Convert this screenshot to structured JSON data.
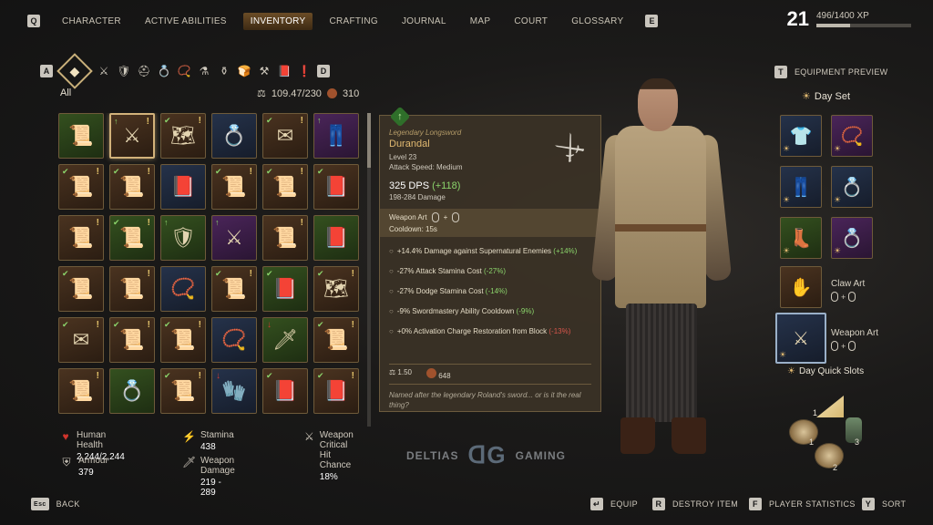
{
  "topnav": {
    "key_left": "Q",
    "key_right": "E",
    "tabs": [
      {
        "label": "CHARACTER",
        "active": false
      },
      {
        "label": "ACTIVE ABILITIES",
        "active": false
      },
      {
        "label": "INVENTORY",
        "active": true
      },
      {
        "label": "CRAFTING",
        "active": false
      },
      {
        "label": "JOURNAL",
        "active": false
      },
      {
        "label": "MAP",
        "active": false
      },
      {
        "label": "COURT",
        "active": false
      },
      {
        "label": "GLOSSARY",
        "active": false
      }
    ]
  },
  "player": {
    "level": "21",
    "xp_text": "496/1400 XP",
    "xp_progress": 0.354
  },
  "categories": {
    "key_left": "A",
    "key_right": "D",
    "filter_label": "All",
    "icons": [
      "all-icon",
      "sword-icon",
      "armor-icon",
      "helmet-icon",
      "ring-icon",
      "amulet-icon",
      "potion-icon",
      "mortar-icon",
      "food-icon",
      "crafting-icon",
      "book-icon",
      "quest-icon"
    ]
  },
  "inventory": {
    "weight": "109.47/230",
    "money": "310",
    "items": [
      {
        "bg": "green",
        "icon": "scroll-icon",
        "ribbon": false,
        "mark": false,
        "up": false,
        "down": false
      },
      {
        "bg": "brown",
        "icon": "sword-icon",
        "ribbon": false,
        "mark": true,
        "up": true,
        "down": false,
        "selected": true
      },
      {
        "bg": "brown",
        "icon": "map-icon",
        "ribbon": true,
        "mark": true,
        "up": false,
        "down": false
      },
      {
        "bg": "blue",
        "icon": "ring-icon",
        "ribbon": false,
        "mark": false,
        "up": false,
        "down": false
      },
      {
        "bg": "brown",
        "icon": "letter-icon",
        "ribbon": true,
        "mark": true,
        "up": false,
        "down": false
      },
      {
        "bg": "purple",
        "icon": "leggings-icon",
        "ribbon": false,
        "mark": false,
        "up": true,
        "down": false
      },
      {
        "bg": "brown",
        "icon": "scroll-icon",
        "ribbon": true,
        "mark": true,
        "up": false,
        "down": false
      },
      {
        "bg": "brown",
        "icon": "scroll-icon",
        "ribbon": true,
        "mark": true,
        "up": false,
        "down": false
      },
      {
        "bg": "blue",
        "icon": "book-icon",
        "ribbon": false,
        "mark": false,
        "up": false,
        "down": false
      },
      {
        "bg": "brown",
        "icon": "scroll-icon",
        "ribbon": true,
        "mark": true,
        "up": false,
        "down": false
      },
      {
        "bg": "brown",
        "icon": "scroll-icon",
        "ribbon": true,
        "mark": true,
        "up": false,
        "down": false
      },
      {
        "bg": "brown",
        "icon": "book-icon",
        "ribbon": true,
        "mark": false,
        "up": false,
        "down": false
      },
      {
        "bg": "brown",
        "icon": "scroll-icon",
        "ribbon": false,
        "mark": true,
        "up": false,
        "down": false
      },
      {
        "bg": "green",
        "icon": "scroll-icon",
        "ribbon": true,
        "mark": true,
        "up": false,
        "down": false
      },
      {
        "bg": "green",
        "icon": "armor-icon",
        "ribbon": false,
        "mark": false,
        "up": true,
        "down": false
      },
      {
        "bg": "purple",
        "icon": "sword-icon",
        "ribbon": false,
        "mark": false,
        "up": true,
        "down": false
      },
      {
        "bg": "brown",
        "icon": "scroll-icon",
        "ribbon": false,
        "mark": true,
        "up": false,
        "down": false
      },
      {
        "bg": "green",
        "icon": "book-icon",
        "ribbon": false,
        "mark": false,
        "up": false,
        "down": false
      },
      {
        "bg": "brown",
        "icon": "scroll-icon",
        "ribbon": true,
        "mark": false,
        "up": false,
        "down": false
      },
      {
        "bg": "brown",
        "icon": "scroll-icon",
        "ribbon": false,
        "mark": true,
        "up": false,
        "down": false
      },
      {
        "bg": "blue",
        "icon": "amulet-icon",
        "ribbon": false,
        "mark": false,
        "up": false,
        "down": false
      },
      {
        "bg": "brown",
        "icon": "scroll-icon",
        "ribbon": true,
        "mark": true,
        "up": false,
        "down": false
      },
      {
        "bg": "green",
        "icon": "book-icon",
        "ribbon": true,
        "mark": false,
        "up": false,
        "down": false
      },
      {
        "bg": "brown",
        "icon": "map-icon",
        "ribbon": true,
        "mark": true,
        "up": false,
        "down": false
      },
      {
        "bg": "brown",
        "icon": "letter-icon",
        "ribbon": true,
        "mark": true,
        "up": false,
        "down": false
      },
      {
        "bg": "brown",
        "icon": "scroll-icon",
        "ribbon": true,
        "mark": true,
        "up": false,
        "down": false
      },
      {
        "bg": "brown",
        "icon": "scroll-icon",
        "ribbon": true,
        "mark": true,
        "up": false,
        "down": false
      },
      {
        "bg": "blue",
        "icon": "amulet-icon",
        "ribbon": false,
        "mark": false,
        "up": false,
        "down": false
      },
      {
        "bg": "green",
        "icon": "dagger-icon",
        "ribbon": false,
        "mark": false,
        "up": false,
        "down": true
      },
      {
        "bg": "brown",
        "icon": "scroll-icon",
        "ribbon": true,
        "mark": true,
        "up": false,
        "down": false
      },
      {
        "bg": "brown",
        "icon": "scroll-icon",
        "ribbon": false,
        "mark": true,
        "up": false,
        "down": false
      },
      {
        "bg": "green",
        "icon": "ring-icon",
        "ribbon": false,
        "mark": false,
        "up": false,
        "down": false
      },
      {
        "bg": "brown",
        "icon": "scroll-icon",
        "ribbon": true,
        "mark": true,
        "up": false,
        "down": false
      },
      {
        "bg": "blue",
        "icon": "gauntlet-icon",
        "ribbon": false,
        "mark": false,
        "up": false,
        "down": true
      },
      {
        "bg": "brown",
        "icon": "book-icon",
        "ribbon": true,
        "mark": false,
        "up": false,
        "down": false
      },
      {
        "bg": "brown",
        "icon": "book-icon",
        "ribbon": true,
        "mark": true,
        "up": false,
        "down": false
      }
    ]
  },
  "tooltip": {
    "type": "Legendary Longsword",
    "name": "Durandal",
    "level": "Level 23",
    "attack_speed": "Attack Speed: Medium",
    "dps": "325 DPS",
    "dps_diff": "(+118)",
    "damage": "198-284 Damage",
    "weapon_art_label": "Weapon Art",
    "cooldown": "Cooldown: 15s",
    "modifiers": [
      {
        "text": "+14.4% Damage against Supernatural Enemies",
        "diff": "(+14%)",
        "color": "g"
      },
      {
        "text": "-27% Attack Stamina Cost",
        "diff": "(-27%)",
        "color": "g"
      },
      {
        "text": "-27% Dodge Stamina Cost",
        "diff": "(-14%)",
        "color": "g"
      },
      {
        "text": "-9% Swordmastery Ability Cooldown",
        "diff": "(-9%)",
        "color": "g"
      },
      {
        "text": "+0% Activation Charge Restoration from Block",
        "diff": "(-13%)",
        "color": "r"
      }
    ],
    "weight": "1.50",
    "value": "648",
    "quote": "Named after the legendary Roland's sword... or is it the real thing?"
  },
  "equipment": {
    "key": "T",
    "title": "EQUIPMENT PREVIEW",
    "day_set": "Day Set",
    "claw_art": "Claw Art",
    "weapon_art": "Weapon Art",
    "quick_slots": "Day Quick Slots",
    "slots": [
      {
        "bg": "blue",
        "icon": "shirt-icon"
      },
      {
        "bg": "purple",
        "icon": "amulet-icon"
      },
      {
        "bg": "blue",
        "icon": "leggings-icon"
      },
      {
        "bg": "blue",
        "icon": "ring-icon"
      },
      {
        "bg": "green",
        "icon": "boots-icon"
      },
      {
        "bg": "purple",
        "icon": "ring-icon"
      }
    ],
    "wheel_numbers": [
      "1",
      "1",
      "3",
      "2"
    ]
  },
  "stats": [
    {
      "icon": "heart-icon",
      "label": "Human Health",
      "value": "2,244/2,244"
    },
    {
      "icon": "stamina-icon",
      "label": "Stamina",
      "value": "438"
    },
    {
      "icon": "crit-icon",
      "label": "Weapon Critical Hit Chance",
      "value": "18%"
    },
    {
      "icon": "armour-icon",
      "label": "Armour",
      "value": "379"
    },
    {
      "icon": "damage-icon",
      "label": "Weapon Damage",
      "value": "219 - 289"
    }
  ],
  "watermark": {
    "left": "DELTIAS",
    "right": "GAMING"
  },
  "bottom": {
    "back_key": "Esc",
    "back": "BACK",
    "equip": "EQUIP",
    "destroy_key": "R",
    "destroy": "DESTROY ITEM",
    "stats_key": "F",
    "stats": "PLAYER STATISTICS",
    "sort_key": "Y",
    "sort": "SORT"
  },
  "colors": {
    "accent": "#c9b07a",
    "positive": "#8bd46b",
    "negative": "#d9564c",
    "legendary": "#e0b870"
  }
}
